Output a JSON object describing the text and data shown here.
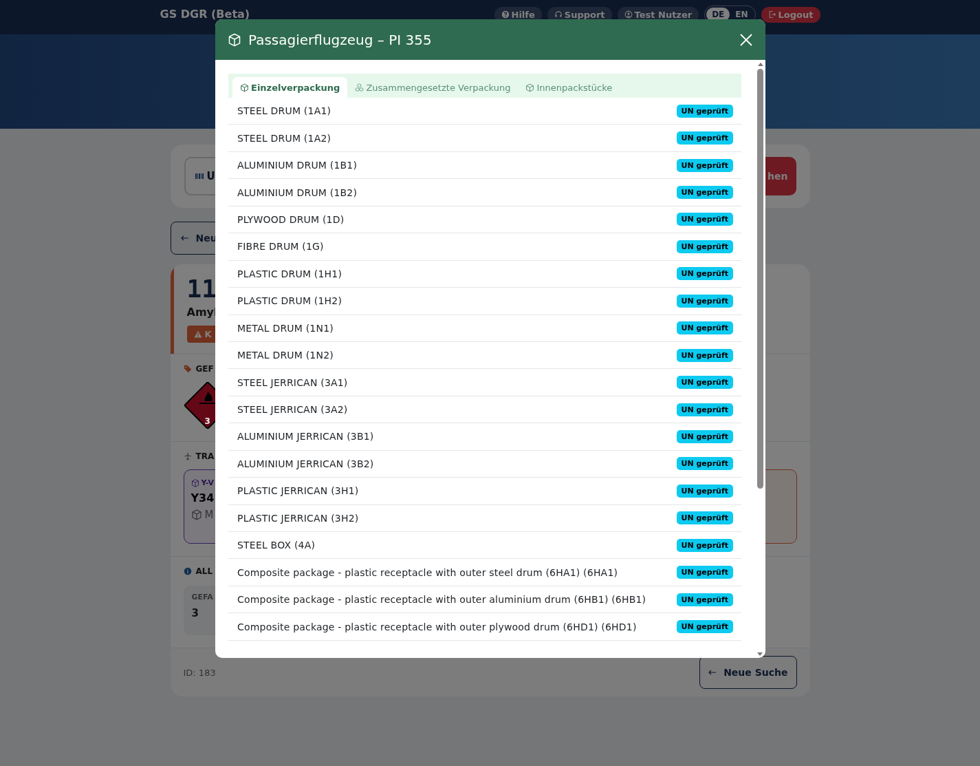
{
  "topbar": {
    "brand": "GS DGR (Beta)",
    "nav": [
      {
        "label": "Hilfe",
        "kind": "help"
      },
      {
        "label": "Support",
        "kind": "support"
      },
      {
        "label": "Test Nutzer",
        "kind": "user"
      }
    ],
    "languages": [
      {
        "label": "DE",
        "selected": true
      },
      {
        "label": "EN",
        "selected": false
      }
    ],
    "logout": "Logout"
  },
  "background": {
    "search_field": "U",
    "search_button": "hen",
    "back_button": "Neu",
    "un_number": "11",
    "substance": "Amyl",
    "warning_badge": "K",
    "hazard_heading": "GEF",
    "hazard_label_class": "3",
    "transport_heading": "TRA",
    "instruction_tag": "Y-V",
    "instruction_code": "Y34",
    "instruction_note": "M",
    "info_heading": "ALL",
    "info_label": "GEFA",
    "info_value": "3",
    "record_id": "ID: 183",
    "new_search": "Neue Suche"
  },
  "modal": {
    "title": "Passagierflugzeug – PI 355",
    "tabs": [
      {
        "label": "Einzelverpackung",
        "kind": "single",
        "selected": true
      },
      {
        "label": "Zusammengesetzte Verpackung",
        "kind": "combined",
        "selected": false
      },
      {
        "label": "Innenpackstücke",
        "kind": "inner",
        "selected": false
      }
    ],
    "rows": [
      {
        "name": "STEEL DRUM (1A1)",
        "badge": "UN geprüft"
      },
      {
        "name": "STEEL DRUM (1A2)",
        "badge": "UN geprüft"
      },
      {
        "name": "ALUMINIUM DRUM (1B1)",
        "badge": "UN geprüft"
      },
      {
        "name": "ALUMINIUM DRUM (1B2)",
        "badge": "UN geprüft"
      },
      {
        "name": "PLYWOOD DRUM (1D)",
        "badge": "UN geprüft"
      },
      {
        "name": "FIBRE DRUM (1G)",
        "badge": "UN geprüft"
      },
      {
        "name": "PLASTIC DRUM (1H1)",
        "badge": "UN geprüft"
      },
      {
        "name": "PLASTIC DRUM (1H2)",
        "badge": "UN geprüft"
      },
      {
        "name": "METAL DRUM (1N1)",
        "badge": "UN geprüft"
      },
      {
        "name": "METAL DRUM (1N2)",
        "badge": "UN geprüft"
      },
      {
        "name": "STEEL JERRICAN (3A1)",
        "badge": "UN geprüft"
      },
      {
        "name": "STEEL JERRICAN (3A2)",
        "badge": "UN geprüft"
      },
      {
        "name": "ALUMINIUM JERRICAN (3B1)",
        "badge": "UN geprüft"
      },
      {
        "name": "ALUMINIUM JERRICAN (3B2)",
        "badge": "UN geprüft"
      },
      {
        "name": "PLASTIC JERRICAN (3H1)",
        "badge": "UN geprüft"
      },
      {
        "name": "PLASTIC JERRICAN (3H2)",
        "badge": "UN geprüft"
      },
      {
        "name": "STEEL BOX (4A)",
        "badge": "UN geprüft"
      },
      {
        "name": "Composite package - plastic receptacle with outer steel drum (6HA1) (6HA1)",
        "badge": "UN geprüft"
      },
      {
        "name": "Composite package - plastic receptacle with outer aluminium drum (6HB1) (6HB1)",
        "badge": "UN geprüft"
      },
      {
        "name": "Composite package - plastic receptacle with outer plywood drum (6HD1) (6HD1)",
        "badge": "UN geprüft"
      }
    ]
  }
}
